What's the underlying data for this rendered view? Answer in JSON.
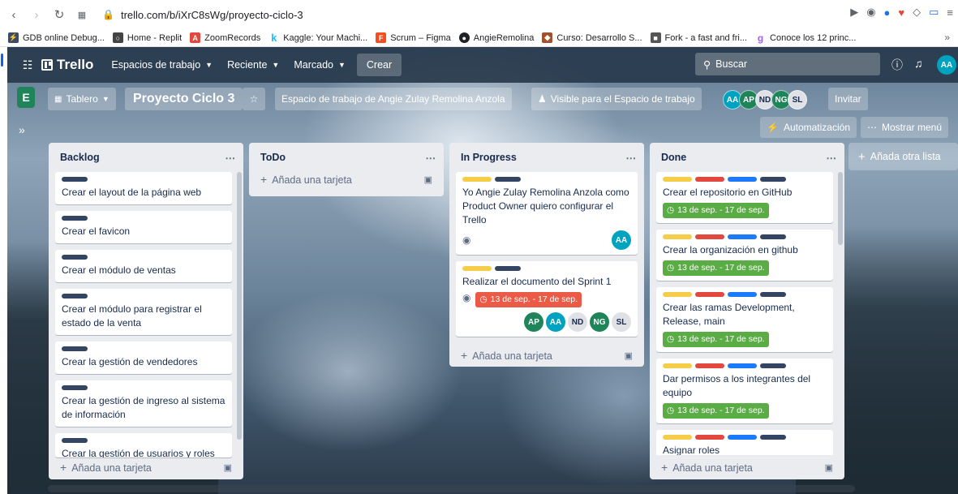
{
  "browser": {
    "url": "trello.com/b/iXrC8sWg/proyecto-ciclo-3",
    "bookmarks": [
      {
        "label": "GDB online Debug...",
        "color": "#3c4a66"
      },
      {
        "label": "Home - Replit",
        "color": "#444"
      },
      {
        "label": "ZoomRecords",
        "color": "#e2483d"
      },
      {
        "label": "Kaggle: Your Machi...",
        "color": "#20beff"
      },
      {
        "label": "Scrum – Figma",
        "color": "#f24e1e"
      },
      {
        "label": "AngieRemolina",
        "color": "#202124"
      },
      {
        "label": "Curso: Desarrollo S...",
        "color": "#a0522d"
      },
      {
        "label": "Fork - a fast and fri...",
        "color": "#555"
      },
      {
        "label": "Conoce los 12 princ...",
        "color": "#a259ff"
      }
    ],
    "bookmarks_more": "»"
  },
  "header": {
    "logo": "Trello",
    "menus": [
      "Espacios de trabajo",
      "Reciente",
      "Marcado"
    ],
    "create": "Crear",
    "search_placeholder": "Buscar",
    "user_initials": "AA"
  },
  "board": {
    "workspace_initial": "E",
    "view": "Tablero",
    "title": "Proyecto Ciclo 3",
    "workspace_name": "Espacio de trabajo de Angie Zulay Remolina Anzola",
    "visibility": "Visible para el Espacio de trabajo",
    "members": [
      "AA",
      "AP",
      "ND",
      "NG",
      "SL"
    ],
    "invite": "Invitar",
    "automation": "Automatización",
    "show_menu": "Mostrar menú",
    "add_list": "Añada otra lista"
  },
  "lists": {
    "backlog": {
      "title": "Backlog",
      "cards": [
        "Crear el layout de la página web",
        "Crear el favicon",
        "Crear el módulo de ventas",
        "Crear el módulo para registrar el estado de la venta",
        "Crear la gestión de vendedores",
        "Crear la gestión de ingreso al sistema de información",
        "Crear la gestión de usuarios y roles"
      ],
      "add_card": "Añada una tarjeta"
    },
    "todo": {
      "title": "ToDo",
      "add_card": "Añada una tarjeta"
    },
    "in_progress": {
      "title": "In Progress",
      "cards": [
        {
          "title": "Yo Angie Zulay Remolina Anzola como Product Owner quiero configurar el Trello",
          "member": "AA"
        },
        {
          "title": "Realizar el documento del Sprint 1",
          "due": "13 de sep. - 17 de sep.",
          "members": [
            "AP",
            "AA",
            "ND",
            "NG",
            "SL"
          ]
        }
      ],
      "add_card": "Añada una tarjeta"
    },
    "done": {
      "title": "Done",
      "cards": [
        {
          "title": "Crear el repositorio en GitHub",
          "due": "13 de sep. - 17 de sep."
        },
        {
          "title": "Crear la organización en github",
          "due": "13 de sep. - 17 de sep."
        },
        {
          "title": "Crear las ramas Development, Release, main",
          "due": "13 de sep. - 17 de sep."
        },
        {
          "title": "Dar permisos a los integrantes del equipo",
          "due": "13 de sep. - 17 de sep."
        },
        {
          "title": "Asignar roles"
        }
      ],
      "add_card": "Añada una tarjeta"
    }
  },
  "colors": {
    "label_yellow": "#f5cd47",
    "label_red": "#e2483d",
    "label_blue": "#1d7afc",
    "label_dark": "#344563",
    "due_green": "#5aac44",
    "due_red": "#eb5a46"
  }
}
